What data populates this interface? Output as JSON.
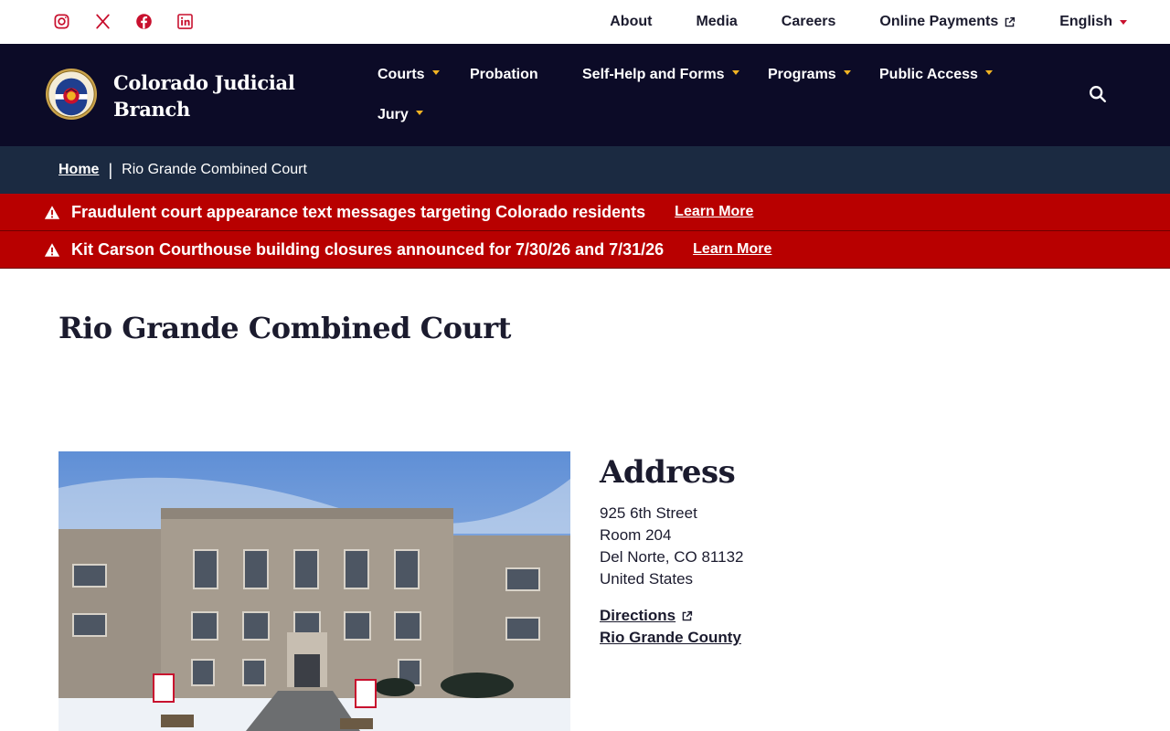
{
  "colors": {
    "nav_bg": "#0c0b27",
    "breadcrumb_bg": "#1b2a41",
    "alert_bg": "#b80000",
    "accent_gold": "#f0b323",
    "accent_red": "#c8102e"
  },
  "social": [
    "instagram-icon",
    "x-icon",
    "facebook-icon",
    "linkedin-icon"
  ],
  "utility_nav": {
    "about": "About",
    "media": "Media",
    "careers": "Careers",
    "online_payments": "Online Payments",
    "language": "English"
  },
  "brand": {
    "line1": "Colorado Judicial",
    "line2": "Branch"
  },
  "main_nav": {
    "courts": "Courts",
    "probation": "Probation",
    "self_help": "Self-Help and Forms",
    "programs": "Programs",
    "public_access": "Public Access",
    "jury": "Jury"
  },
  "breadcrumb": {
    "home": "Home",
    "separator": "|",
    "current": "Rio Grande Combined Court"
  },
  "alerts": [
    {
      "message": "Fraudulent court appearance text messages targeting Colorado residents",
      "link": "Learn More"
    },
    {
      "message": "Kit Carson Courthouse building closures announced for 7/30/26 and 7/31/26",
      "link": "Learn More"
    }
  ],
  "page": {
    "title": "Rio Grande Combined Court"
  },
  "address": {
    "heading": "Address",
    "line1": "925 6th Street",
    "line2": "Room 204",
    "line3": "Del Norte, CO 81132",
    "line4": "United States",
    "directions": "Directions",
    "county": "Rio Grande County"
  }
}
